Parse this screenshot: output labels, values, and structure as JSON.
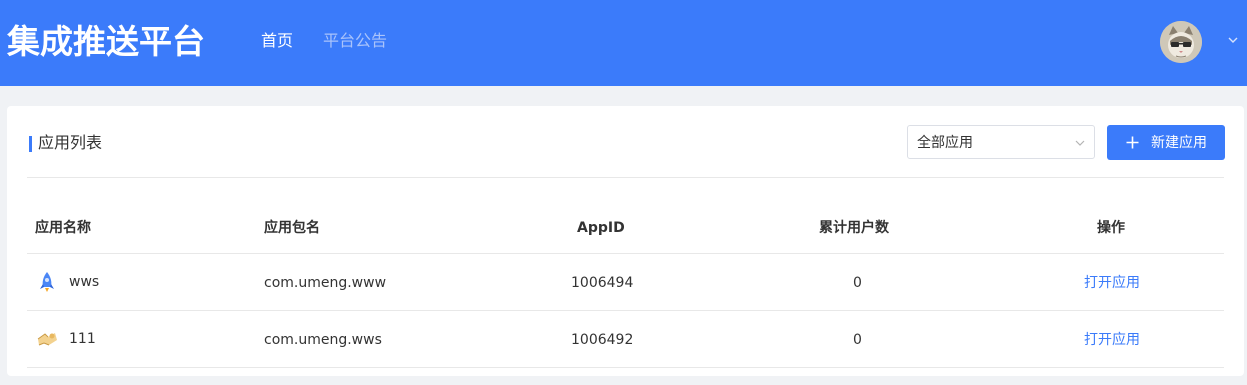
{
  "header": {
    "brand": "集成推送平台",
    "nav": [
      {
        "label": "首页",
        "active": true
      },
      {
        "label": "平台公告",
        "active": false
      }
    ],
    "avatar_icon": "cat-avatar-icon",
    "menu_icon": "chevron-down-icon"
  },
  "main": {
    "section_title": "应用列表",
    "filter": {
      "selected": "全部应用"
    },
    "new_button_label": "新建应用",
    "table": {
      "headers": [
        "应用名称",
        "应用包名",
        "AppID",
        "累计用户数",
        "操作"
      ],
      "rows": [
        {
          "icon": "rocket-app-icon",
          "name": "wws",
          "package": "com.umeng.www",
          "appid": "1006494",
          "users": "0",
          "action": "打开应用"
        },
        {
          "icon": "puzzle-app-icon",
          "name": "111",
          "package": "com.umeng.wws",
          "appid": "1006492",
          "users": "0",
          "action": "打开应用"
        }
      ]
    }
  },
  "colors": {
    "brand_blue": "#3b7bfa",
    "nav_inactive": "#a9c3fb",
    "page_bg": "#f0f2f5"
  }
}
